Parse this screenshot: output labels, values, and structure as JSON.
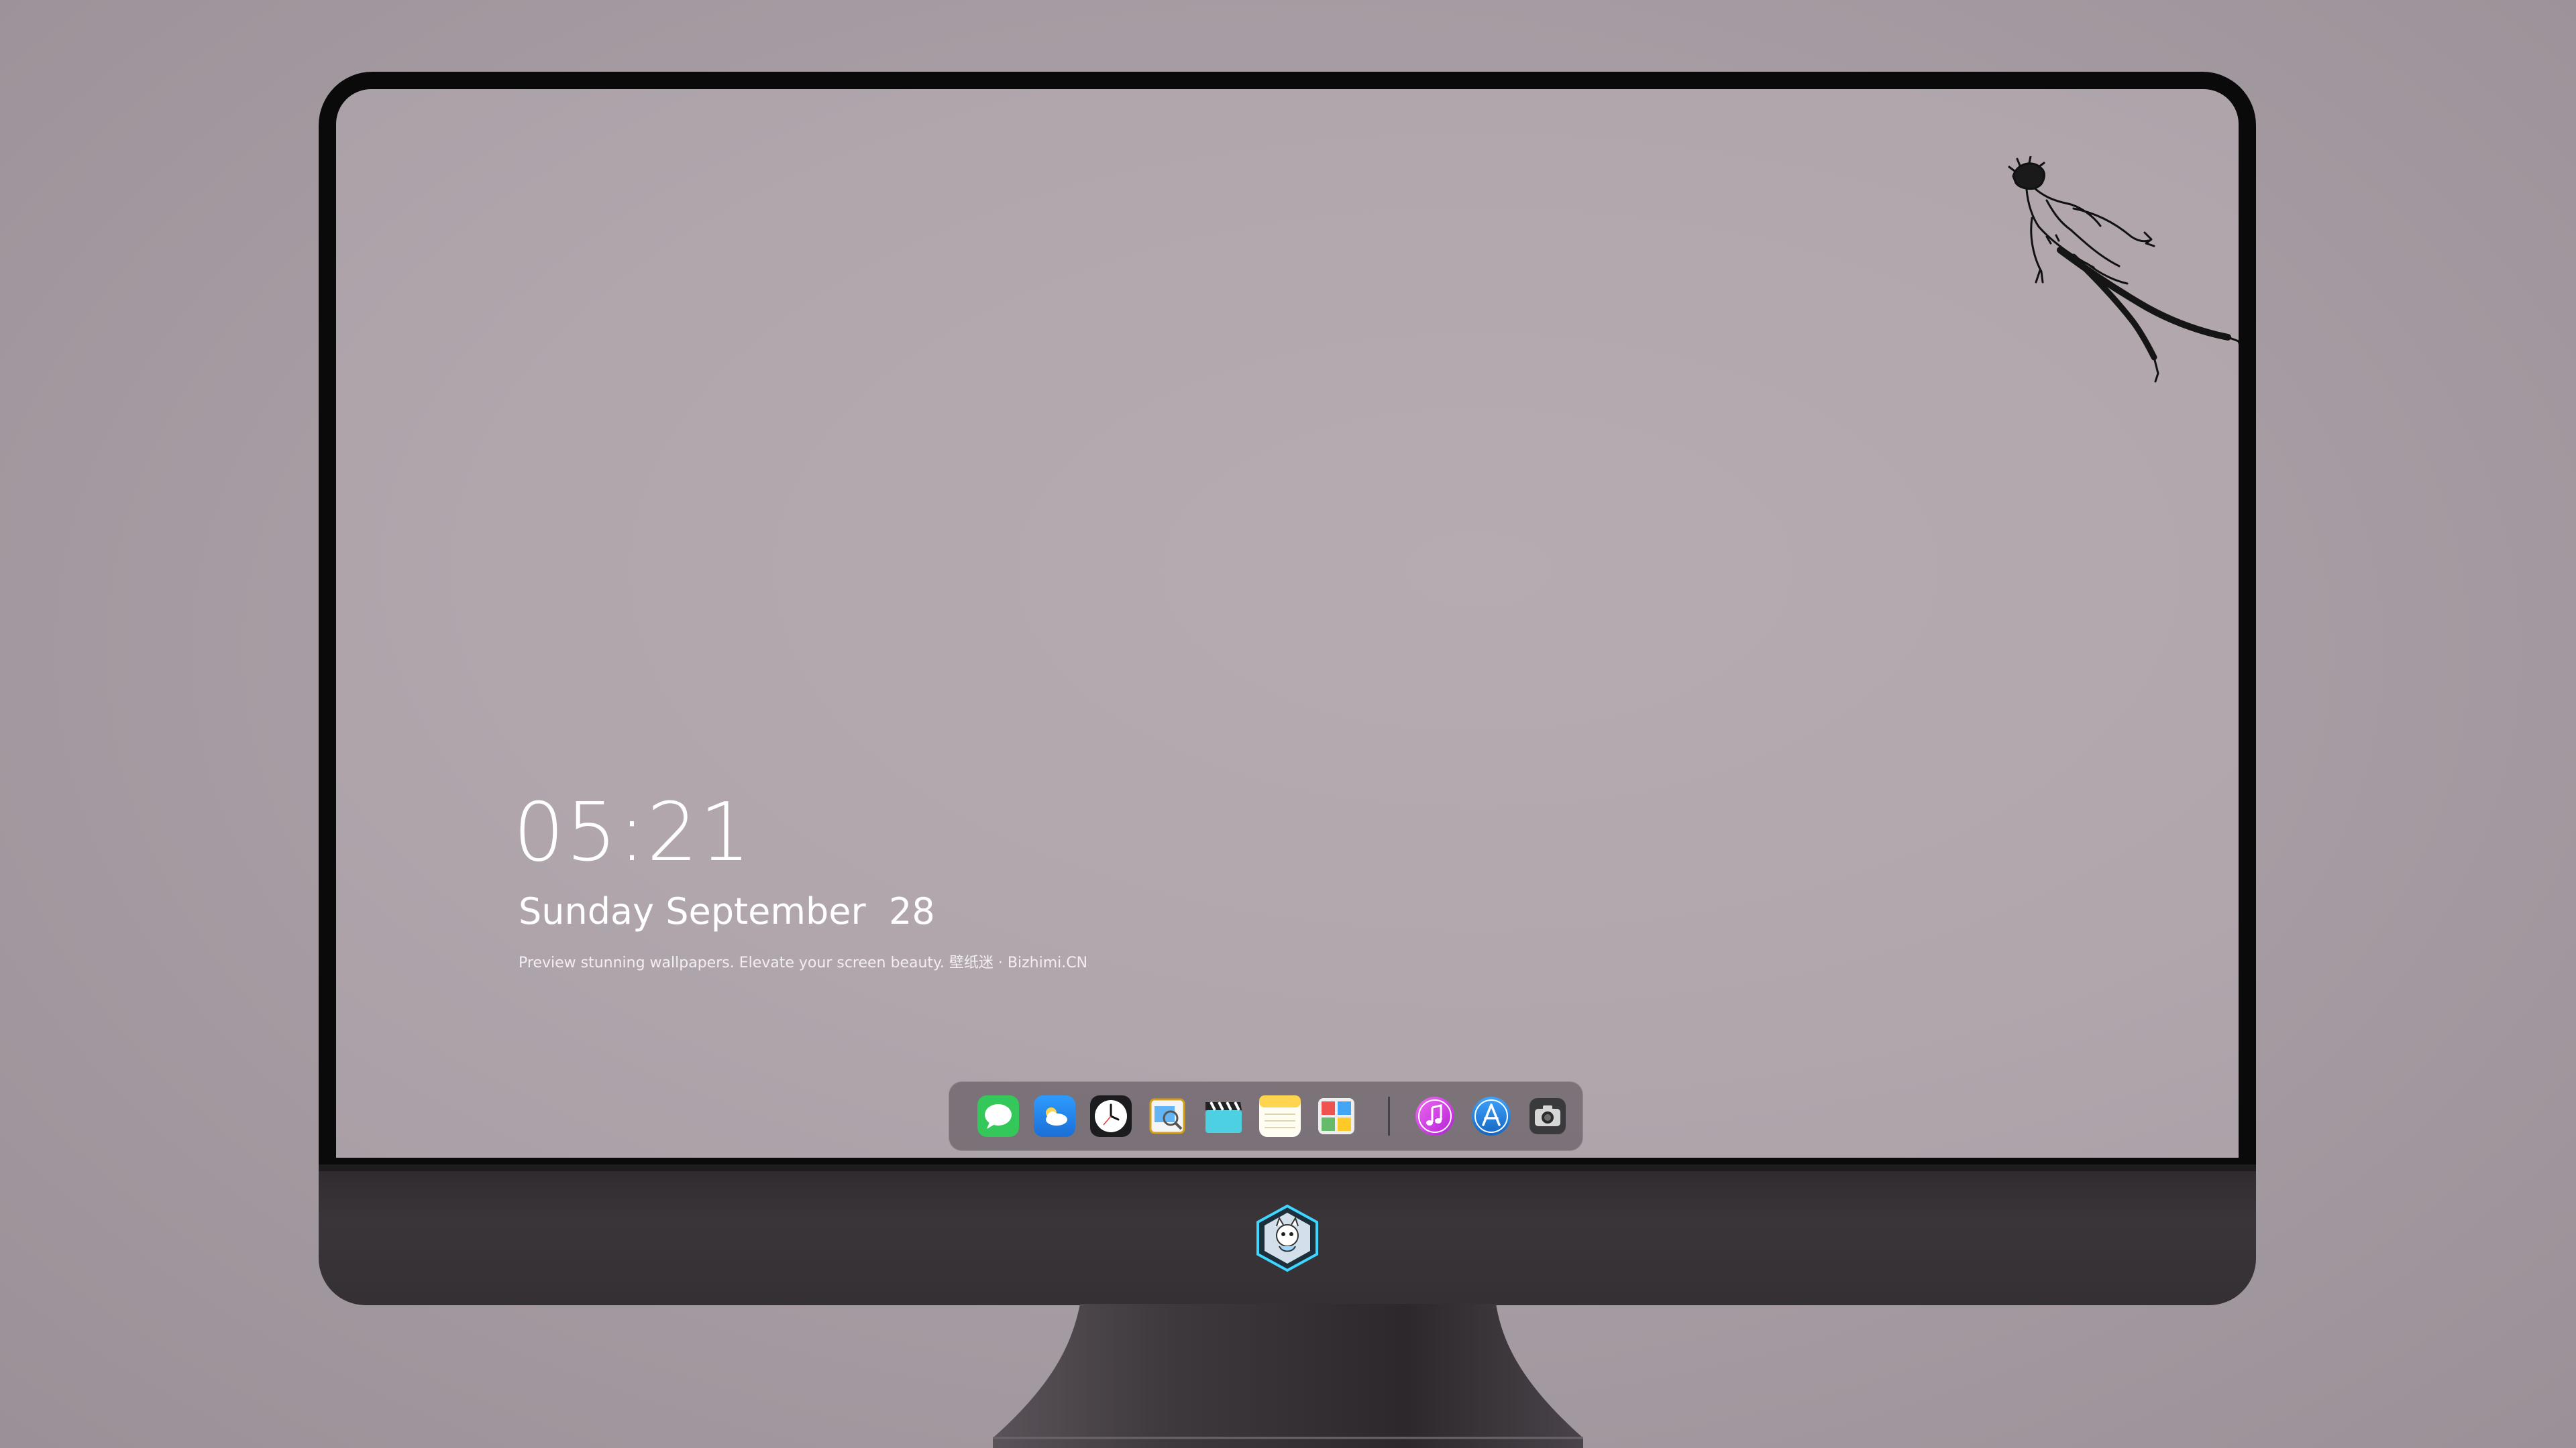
{
  "lock_screen": {
    "time": "05:21",
    "date": "Sunday September  28",
    "tagline": "Preview stunning wallpapers. Elevate your screen beauty. 壁纸迷 · Bizhimi.CN"
  },
  "dock": {
    "apps": [
      {
        "icon": "messages-icon",
        "color": "#34c759"
      },
      {
        "icon": "weather-icon",
        "color": "#1e90ff"
      },
      {
        "icon": "clock-icon",
        "color": "#1c1c1e"
      },
      {
        "icon": "preview-icon",
        "color": "#f5c542"
      },
      {
        "icon": "clapperboard-icon",
        "color": "#4dd0e1"
      },
      {
        "icon": "notes-icon",
        "color": "#ffd54f"
      },
      {
        "icon": "photo-booth-icon",
        "color": "#e0e0e0"
      },
      {
        "icon": "music-icon",
        "color": "#e040fb"
      },
      {
        "icon": "app-store-icon",
        "color": "#1e88e5"
      },
      {
        "icon": "camera-icon",
        "color": "#5c5c5c"
      }
    ]
  },
  "colors": {
    "background": "#a69ca3",
    "screen": "#b0a6ac",
    "bezel": "#0b0a0b",
    "chin": "#353034"
  }
}
